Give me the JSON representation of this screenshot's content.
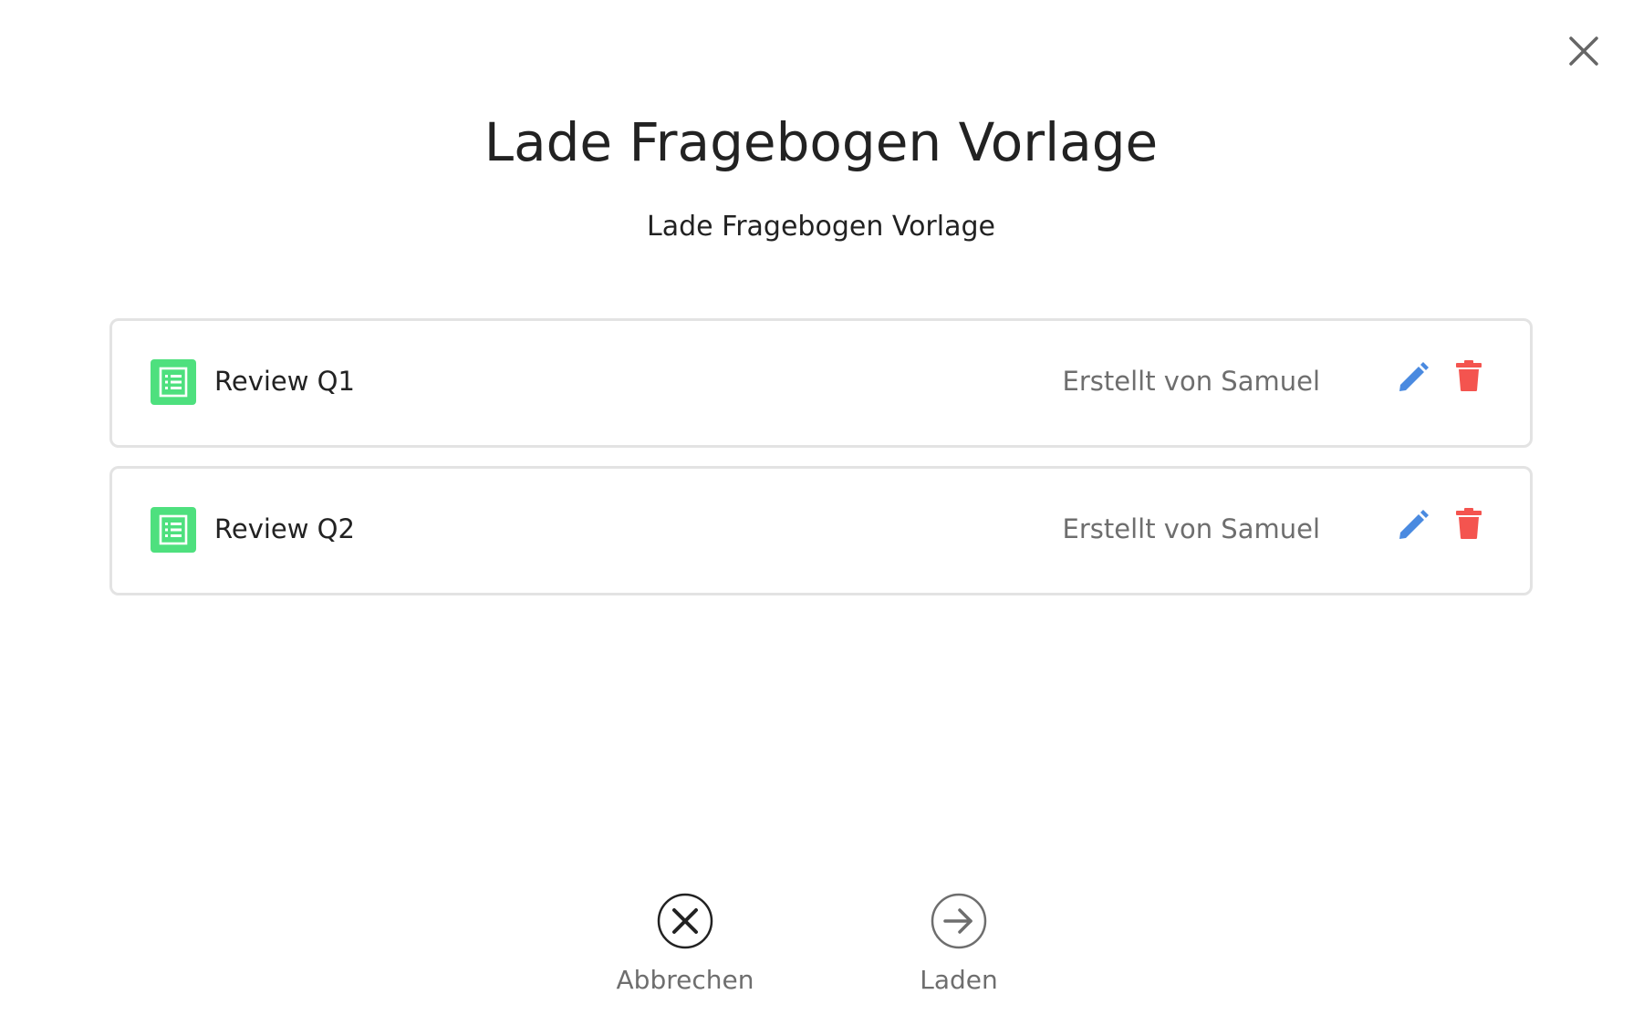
{
  "dialog": {
    "title": "Lade Fragebogen Vorlage",
    "subtitle": "Lade Fragebogen Vorlage"
  },
  "templates": [
    {
      "name": "Review Q1",
      "author": "Erstellt von Samuel",
      "icon": "list-document-icon"
    },
    {
      "name": "Review Q2",
      "author": "Erstellt von Samuel",
      "icon": "list-document-icon"
    }
  ],
  "actions": {
    "cancel_label": "Abbrechen",
    "load_label": "Laden"
  },
  "icons": {
    "close": "close-icon",
    "edit": "pencil-icon",
    "delete": "trash-icon",
    "cancel": "circle-x-icon",
    "load": "circle-arrow-right-icon"
  },
  "colors": {
    "template_icon": "#4ee07e",
    "edit": "#4a8ae0",
    "delete": "#f4544f",
    "text_primary": "#222222",
    "text_secondary": "#6e6e6e",
    "card_border": "#e3e3e3"
  }
}
